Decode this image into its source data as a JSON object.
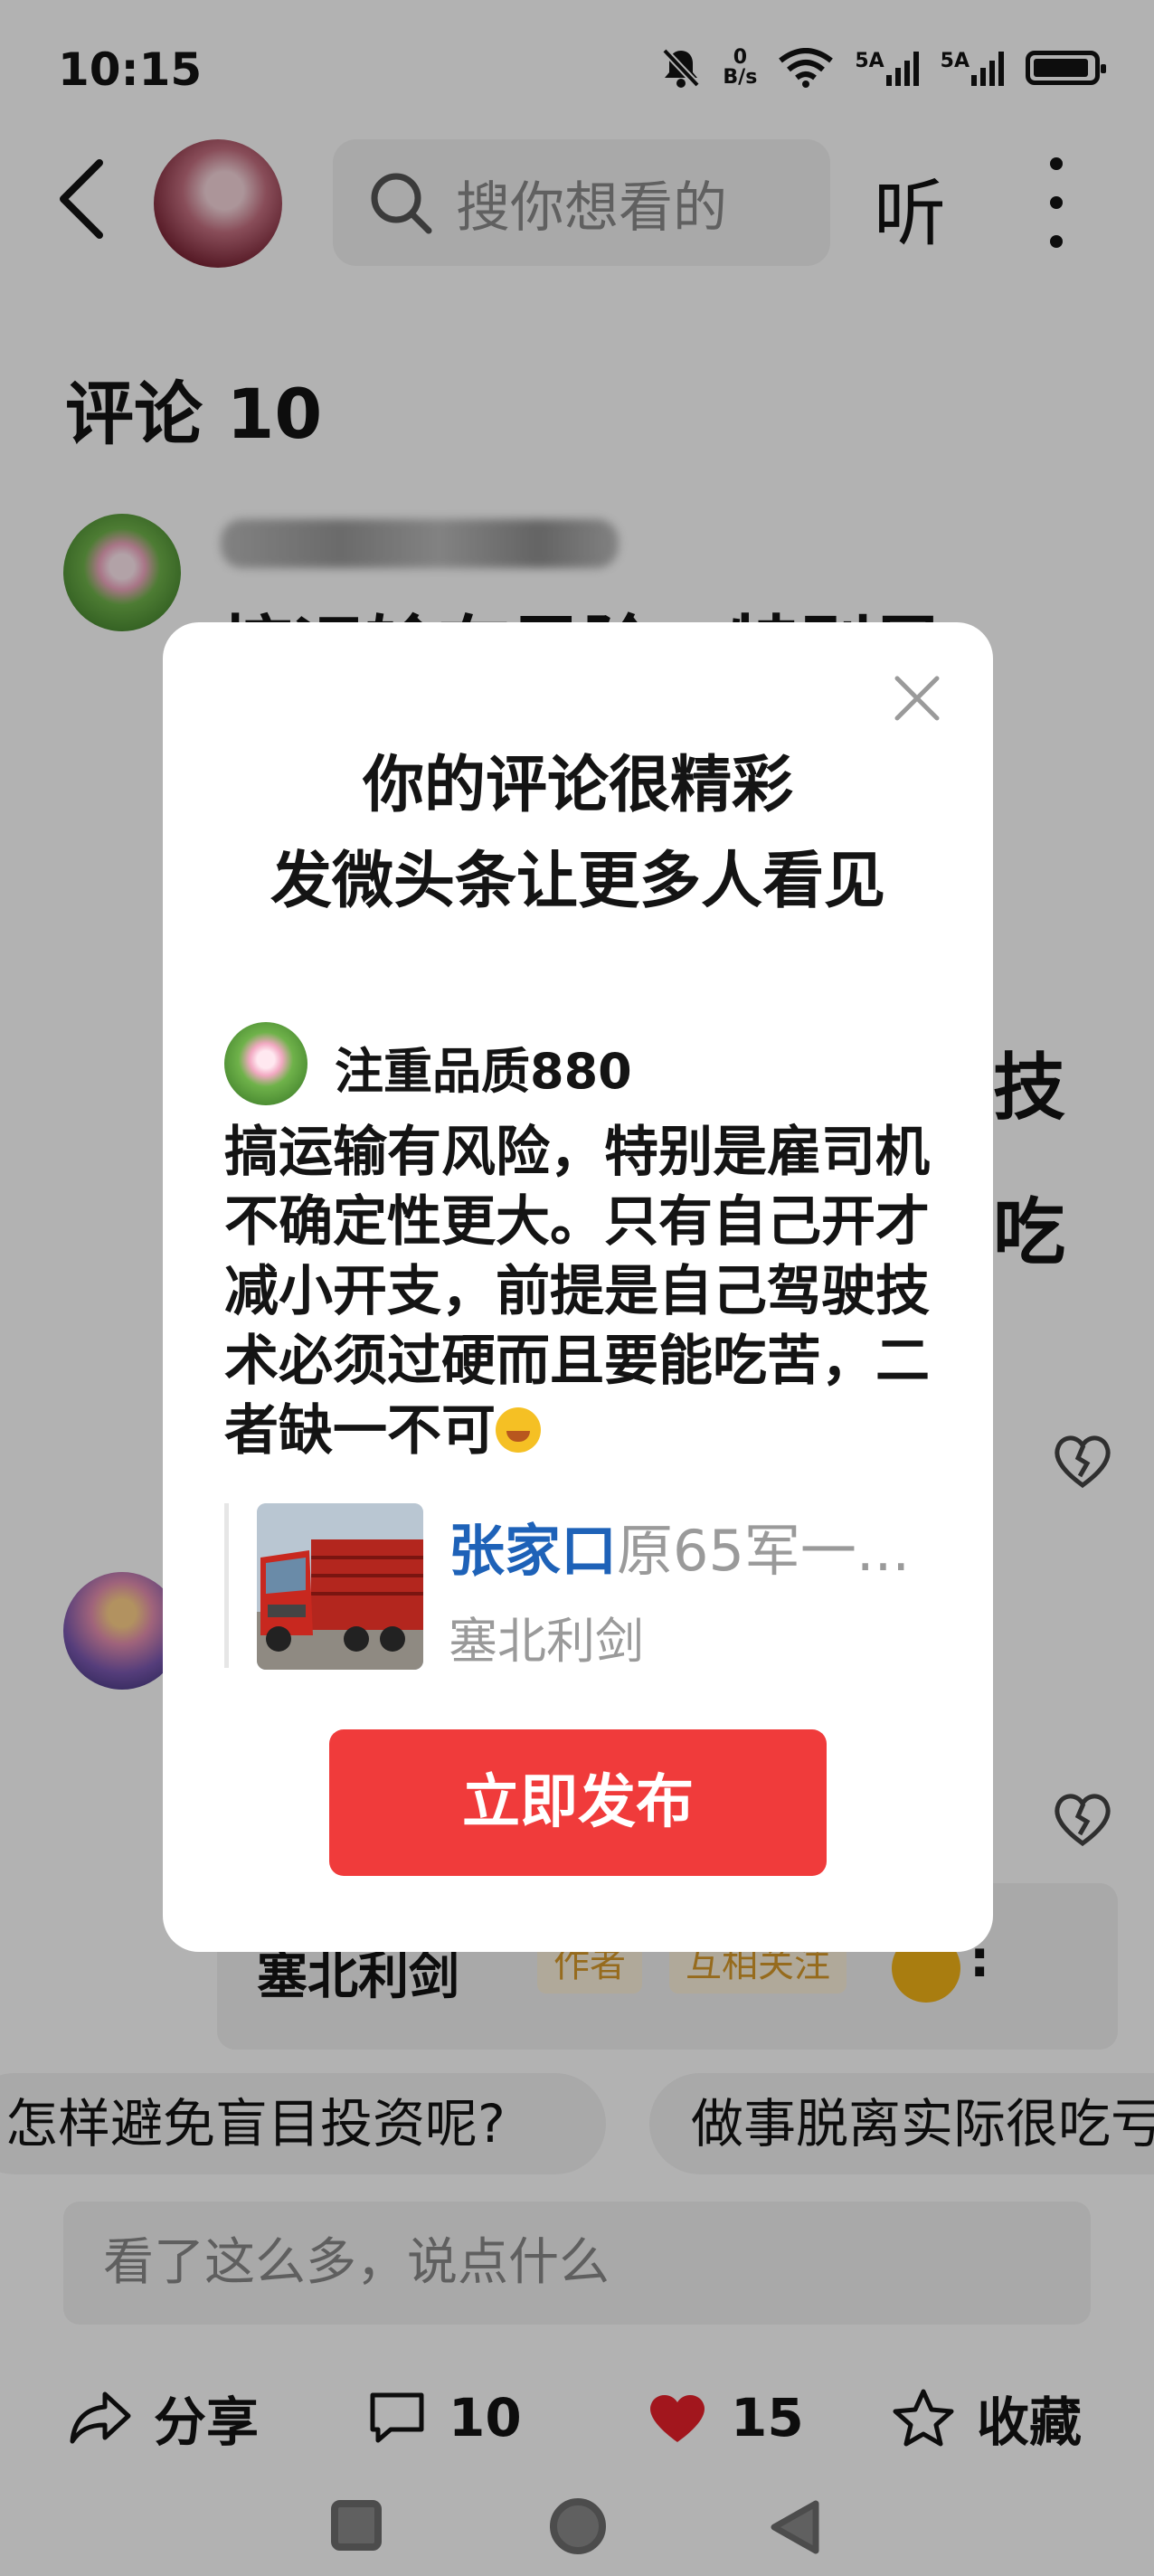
{
  "status_bar": {
    "time": "10:15",
    "net_speed_top": "0",
    "net_speed_bottom": "B/s",
    "sim1": "5A",
    "sim2": "5A"
  },
  "header": {
    "search_placeholder": "搜你想看的",
    "listen_label": "听"
  },
  "comments": {
    "title": "评论 10",
    "first_comment_peek": [
      "搞运输有风险，特别是",
      "技",
      "吃"
    ],
    "reply": {
      "name": "塞北利剑",
      "tags": [
        "作者",
        "互相关注"
      ],
      "colon": ":"
    }
  },
  "suggestions": [
    "怎样避免盲目投资呢?",
    "做事脱离实际很吃亏"
  ],
  "comment_input_placeholder": "看了这么多，说点什么",
  "actions": {
    "share": "分享",
    "comments": "10",
    "likes": "15",
    "favorite": "收藏"
  },
  "modal": {
    "title_line1": "你的评论很精彩",
    "title_line2": "发微头条让更多人看见",
    "username": "注重品质880",
    "comment_text": "搞运输有风险，特别是雇司机不确定性更大。只有自己开才减小开支，前提是自己驾驶技术必须过硬而且要能吃苦，二者缺一不可",
    "quote_title_highlight": "张家口",
    "quote_title_rest": "原65军一...",
    "quote_author": "塞北利剑",
    "publish_button": "立即发布"
  },
  "colors": {
    "accent_red": "#f03b3b",
    "link_blue": "#1e62b8",
    "tag_orange": "#d79a2a"
  }
}
